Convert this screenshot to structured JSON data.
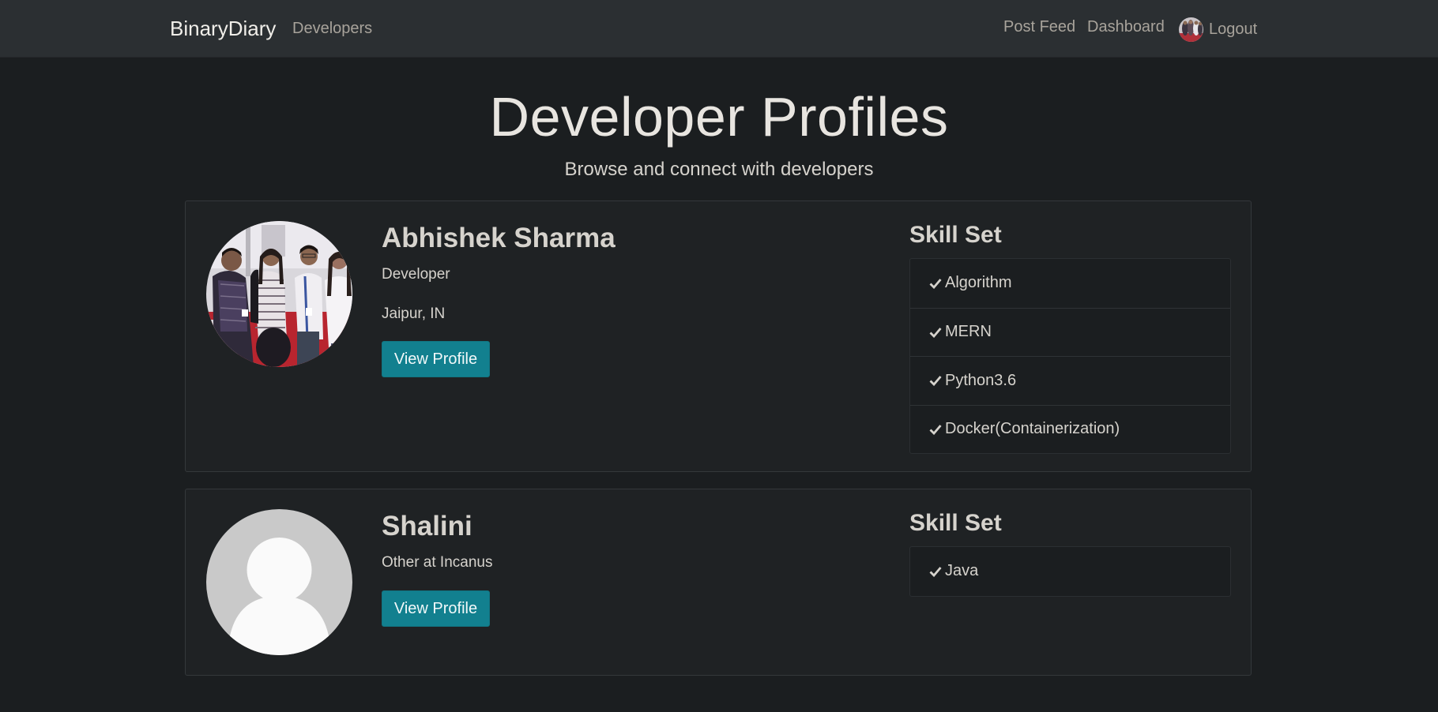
{
  "navbar": {
    "brand": "BinaryDiary",
    "developers": "Developers",
    "post_feed": "Post Feed",
    "dashboard": "Dashboard",
    "logout": "Logout"
  },
  "header": {
    "title": "Developer Profiles",
    "lead": "Browse and connect with developers"
  },
  "profiles": [
    {
      "name": "Abhishek Sharma",
      "status": "Developer",
      "location": "Jaipur, IN",
      "button_label": "View Profile",
      "skills_title": "Skill Set",
      "skills": [
        "Algorithm",
        "MERN",
        "Python3.6",
        "Docker(Containerization)"
      ]
    },
    {
      "name": "Shalini",
      "status": "Other at Incanus",
      "button_label": "View Profile",
      "skills_title": "Skill Set",
      "skills": [
        "Java"
      ]
    }
  ],
  "colors": {
    "background": "#1b1e20",
    "navbar": "#2b2f32",
    "card": "#1f2224",
    "button": "#12808f"
  }
}
